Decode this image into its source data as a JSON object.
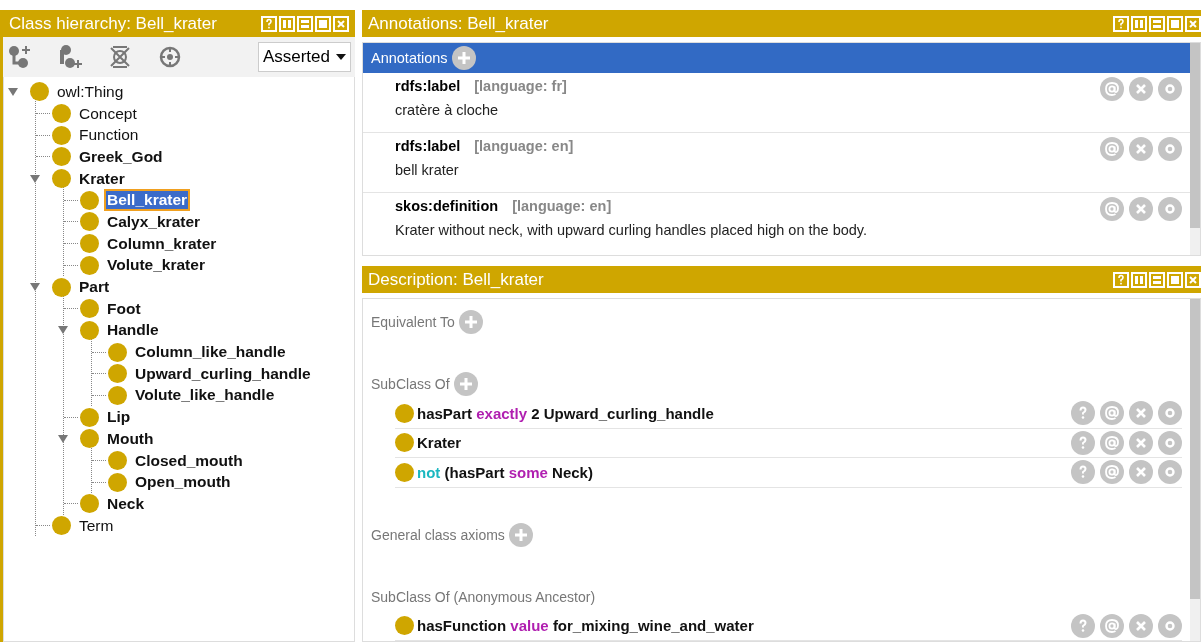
{
  "hierarchy": {
    "title": "Class hierarchy: Bell_krater",
    "mode": "Asserted",
    "tree": [
      {
        "label": "owl:Thing",
        "bold": false,
        "selected": false,
        "expanded": true,
        "children": [
          {
            "label": "Concept",
            "bold": false,
            "selected": false
          },
          {
            "label": "Function",
            "bold": false,
            "selected": false
          },
          {
            "label": "Greek_God",
            "bold": true,
            "selected": false
          },
          {
            "label": "Krater",
            "bold": true,
            "selected": false,
            "expanded": true,
            "children": [
              {
                "label": "Bell_krater",
                "bold": true,
                "selected": true
              },
              {
                "label": "Calyx_krater",
                "bold": true,
                "selected": false
              },
              {
                "label": "Column_krater",
                "bold": true,
                "selected": false
              },
              {
                "label": "Volute_krater",
                "bold": true,
                "selected": false
              }
            ]
          },
          {
            "label": "Part",
            "bold": true,
            "selected": false,
            "expanded": true,
            "children": [
              {
                "label": "Foot",
                "bold": true,
                "selected": false
              },
              {
                "label": "Handle",
                "bold": true,
                "selected": false,
                "expanded": true,
                "children": [
                  {
                    "label": "Column_like_handle",
                    "bold": true,
                    "selected": false
                  },
                  {
                    "label": "Upward_curling_handle",
                    "bold": true,
                    "selected": false
                  },
                  {
                    "label": "Volute_like_handle",
                    "bold": true,
                    "selected": false
                  }
                ]
              },
              {
                "label": "Lip",
                "bold": true,
                "selected": false
              },
              {
                "label": "Mouth",
                "bold": true,
                "selected": false,
                "expanded": true,
                "children": [
                  {
                    "label": "Closed_mouth",
                    "bold": true,
                    "selected": false
                  },
                  {
                    "label": "Open_mouth",
                    "bold": true,
                    "selected": false
                  }
                ]
              },
              {
                "label": "Neck",
                "bold": true,
                "selected": false
              }
            ]
          },
          {
            "label": "Term",
            "bold": false,
            "selected": false
          }
        ]
      }
    ]
  },
  "annotations": {
    "title": "Annotations: Bell_krater",
    "section": "Annotations",
    "items": [
      {
        "property": "rdfs:label",
        "language": "[language: fr]",
        "value": "cratère à cloche"
      },
      {
        "property": "rdfs:label",
        "language": "[language: en]",
        "value": "bell krater"
      },
      {
        "property": "skos:definition",
        "language": "[language: en]",
        "value": "Krater without neck, with upward curling handles placed high on the body."
      }
    ]
  },
  "description": {
    "title": "Description: Bell_krater",
    "sections": [
      {
        "title": "Equivalent To",
        "addable": true
      },
      {
        "title": "SubClass Of",
        "addable": true,
        "items": [
          {
            "parts": [
              {
                "text": "hasPart",
                "kind": "plain"
              },
              {
                "text": "exactly",
                "kind": "keyword"
              },
              {
                "text": "2 Upward_curling_handle",
                "kind": "plain"
              }
            ]
          },
          {
            "parts": [
              {
                "text": "Krater",
                "kind": "plain"
              }
            ]
          },
          {
            "parts": [
              {
                "text": "not",
                "kind": "negation"
              },
              {
                "text": "(hasPart",
                "kind": "plain"
              },
              {
                "text": "some",
                "kind": "keyword"
              },
              {
                "text": "Neck)",
                "kind": "plain"
              }
            ]
          }
        ]
      },
      {
        "title": "General class axioms",
        "addable": true
      },
      {
        "title": "SubClass Of (Anonymous Ancestor)",
        "addable": false,
        "items": [
          {
            "parts": [
              {
                "text": "hasFunction",
                "kind": "plain"
              },
              {
                "text": "value",
                "kind": "keyword"
              },
              {
                "text": "for_mixing_wine_and_water",
                "kind": "plain"
              }
            ]
          }
        ]
      }
    ]
  }
}
